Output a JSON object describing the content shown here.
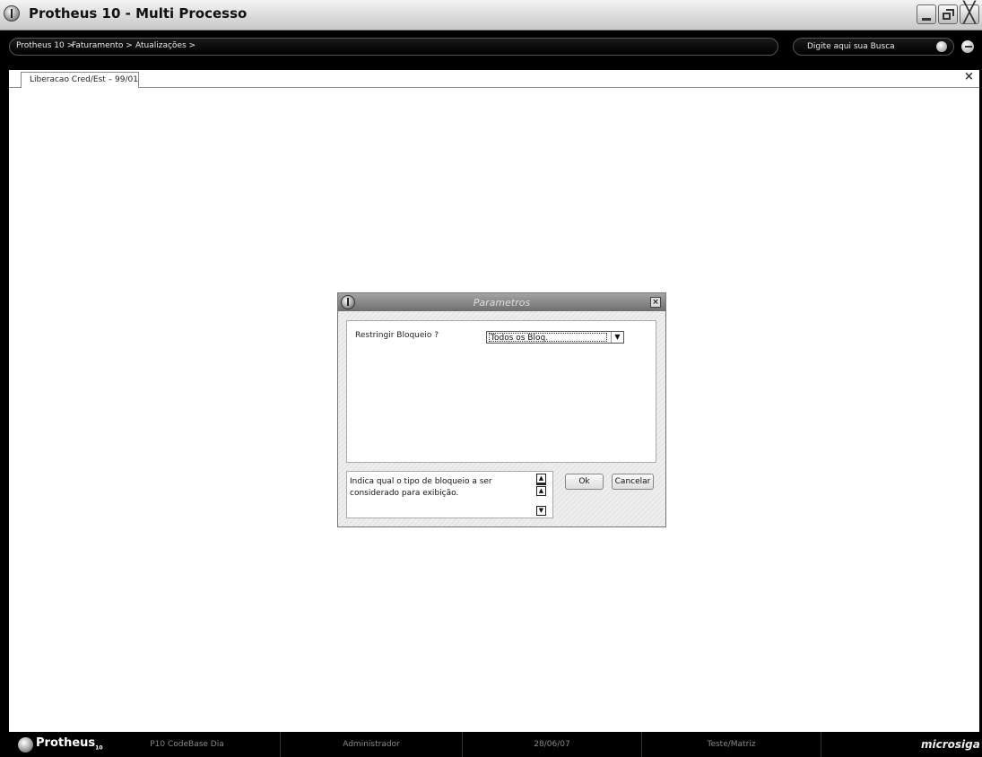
{
  "window": {
    "title": "Protheus 10 - Multi Processo",
    "close_glyph": "╳"
  },
  "breadcrumb": [
    "Protheus 10 >",
    "Faturamento >",
    "Atualizações >"
  ],
  "search": {
    "placeholder": "Digite aqui sua Busca"
  },
  "tab": {
    "label": "Liberacao Cred/Est – 99/01",
    "close_glyph": "×"
  },
  "dialog": {
    "title": "Parametros",
    "close_glyph": "×",
    "param_label": "Restringir Bloqueio ?",
    "param_value": "Todos os Bloq.",
    "select_arrow": "▼",
    "help_text": "Indica qual o tipo de bloqueio a ser considerado para exibição.",
    "scroll_up": "▲",
    "scroll_down": "▼",
    "ok_label": "Ok",
    "cancel_label": "Cancelar"
  },
  "statusbar": {
    "brand": "Protheus",
    "brand_version": "10",
    "environment": "P10 CodeBase Dia",
    "user": "Administrador",
    "date": "28/06/07",
    "branch": "Teste/Matriz",
    "vendor": "microsiga"
  },
  "colors": {
    "chrome": "#000000",
    "dialog_title": "#7a7a7a",
    "workspace": "#ffffff"
  }
}
